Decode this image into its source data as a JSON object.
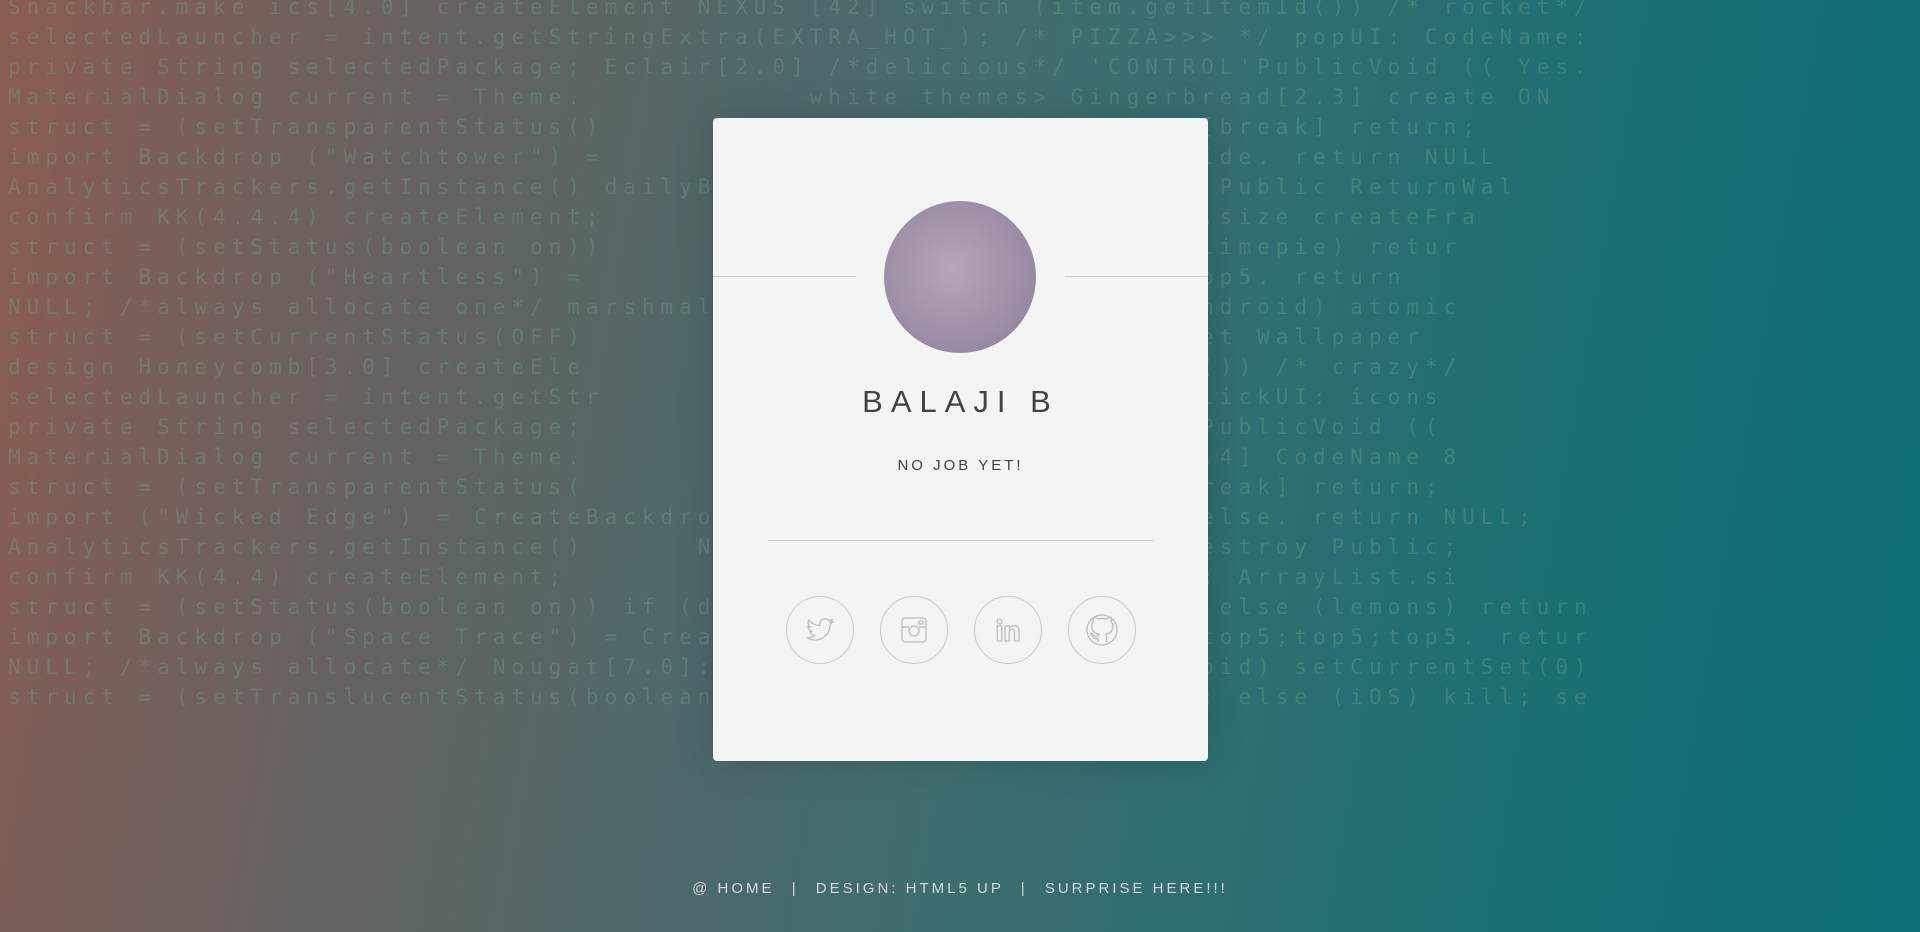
{
  "background_code": {
    "lines": [
      "Snackbar.make ics[4.0] createElement NEXUS [42] switch (item.getItemId()) /* rocket*/",
      "selectedLauncher = intent.getStringExtra(EXTRA_HOT_); /* PIZZA>>> */ popUI: CodeName:",
      "private String selectedPackage; Eclair[2.0] /*delicious*/ 'CONTROL'PublicVoid (( Yes.",
      "MaterialDialog current = Theme.            white themes> Gingerbread[2.3] create ON",
      "struct = (setTransparentStatus()           droid) confirm; else [break] return;",
      "import Backdrop (\"Watchtower\") =             PublicVoid;; @override. return NULL",
      "AnalyticsTrackers.getInstance() dailyBack        ne (\"dolphins\") Public ReturnWal",
      "confirm KK(4.4.4) createElement;              command; ArrayList.size createFra",
      "struct = (setStatus(boolean on))              confirm; else (keylimepie) retur",
      "import Backdrop (\"Heartless\") =               Void;; top5;top5;top5. return",
      "NULL; /*always allocate one*/ marshmal         onsItemSelected(Android) atomic",
      "struct = (setCurrentStatus(OFF)               else (web) kill; set Wallpaper",
      "design Honeycomb[3.0] createEle               ch (item.getItemId()) /* crazy*/",
      "selectedLauncher = intent.getStr              /* lasagna>>> */ clickUI: icons",
      "private String selectedPackage;               icious*/ 'CONTROL'PublicVoid ((",
      "MaterialDialog current = Theme.            bright themes> GB[2.3.4] CodeName 8",
      "struct = (setTransparentStatus(            oid) confirm; else [break] return;",
      "import (\"Wicked Edge\") = CreateBackdrop           ArrayList .if else. return NULL;",
      "AnalyticsTrackers.getInstance()      Nexus 7 NodeName (\"rice\") destroy Public;",
      "confirm KK(4.4) createElement;              212)) export command; ArrayList.si",
      "struct = (setStatus(boolean on)) if (diordnA) backwards confirm; else (lemons) return",
      "import Backdrop (\"Space Trace\") = CreateWallpaper. PublicVoid;; top5;top5;top5. retur",
      "NULL; /*always allocate*/ Nougat[7.0]: OptionsItemSelected (Android) setCurrentSet(0)",
      "struct = (setTranslucentStatus(boolean on)) if (Android) confirm; else (iOS) kill; se"
    ]
  },
  "profile": {
    "name": "BALAJI B",
    "job": "NO JOB YET!"
  },
  "socials": [
    {
      "name": "twitter",
      "icon": "twitter-icon"
    },
    {
      "name": "instagram",
      "icon": "instagram-icon"
    },
    {
      "name": "linkedin",
      "icon": "linkedin-icon"
    },
    {
      "name": "github",
      "icon": "github-icon"
    }
  ],
  "footer": {
    "home": "@ HOME",
    "separator": "|",
    "design": "DESIGN: HTML5 UP",
    "surprise": "SURPRISE HERE!!!"
  },
  "colors": {
    "card": "#f3f5f5",
    "text": "#3d4346",
    "icon_stroke": "#b8bdc0"
  }
}
